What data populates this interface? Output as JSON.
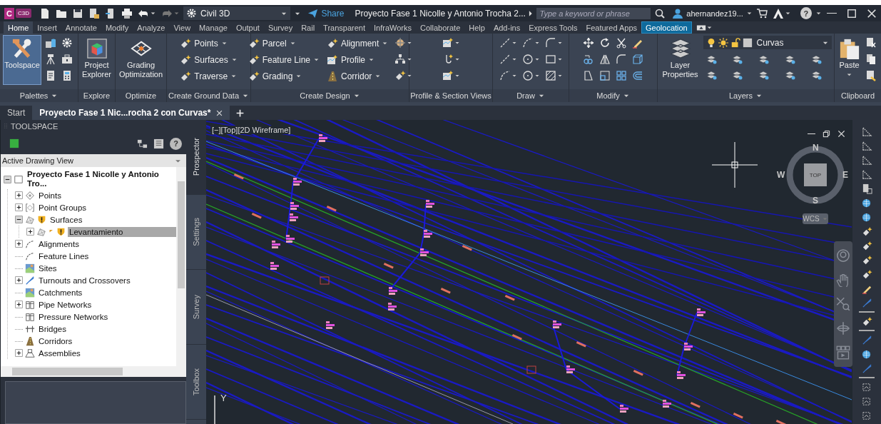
{
  "title_bar": {
    "app_letter": "C",
    "app_badge": "C3D",
    "workspace": "Civil 3D",
    "share": "Share",
    "document_title": "Proyecto Fase 1 Nicolle y Antonio Trocha 2...",
    "search": {
      "placeholder": "Type a keyword or phrase"
    },
    "user": "ahernandez19...",
    "help": "?"
  },
  "ribbon_tabs": [
    {
      "label": "Home",
      "selected": true,
      "highlighted": false
    },
    {
      "label": "Insert",
      "selected": false,
      "highlighted": false
    },
    {
      "label": "Annotate",
      "selected": false,
      "highlighted": false
    },
    {
      "label": "Modify",
      "selected": false,
      "highlighted": false
    },
    {
      "label": "Analyze",
      "selected": false,
      "highlighted": false
    },
    {
      "label": "View",
      "selected": false,
      "highlighted": false
    },
    {
      "label": "Manage",
      "selected": false,
      "highlighted": false
    },
    {
      "label": "Output",
      "selected": false,
      "highlighted": false
    },
    {
      "label": "Survey",
      "selected": false,
      "highlighted": false
    },
    {
      "label": "Rail",
      "selected": false,
      "highlighted": false
    },
    {
      "label": "Transparent",
      "selected": false,
      "highlighted": false
    },
    {
      "label": "InfraWorks",
      "selected": false,
      "highlighted": false
    },
    {
      "label": "Collaborate",
      "selected": false,
      "highlighted": false
    },
    {
      "label": "Help",
      "selected": false,
      "highlighted": false
    },
    {
      "label": "Add-ins",
      "selected": false,
      "highlighted": false
    },
    {
      "label": "Express Tools",
      "selected": false,
      "highlighted": false
    },
    {
      "label": "Featured Apps",
      "selected": false,
      "highlighted": false
    },
    {
      "label": "Geolocation",
      "selected": false,
      "highlighted": true
    }
  ],
  "ribbon_panels": [
    {
      "label": "Palettes",
      "menu": true,
      "buttons": [
        {
          "kind": "large",
          "label": "Toolspace",
          "menu": false,
          "active": true
        }
      ]
    },
    {
      "label": "Explore",
      "menu": false,
      "buttons": [
        {
          "kind": "large",
          "label": "Project Explorer",
          "menu": false,
          "active": false
        }
      ]
    },
    {
      "label": "Optimize",
      "menu": false,
      "buttons": [
        {
          "kind": "large",
          "label": "Grading Optimization",
          "menu": false,
          "active": false
        }
      ]
    },
    {
      "label": "Create Ground Data",
      "menu": true,
      "buttons": [
        {
          "kind": "small",
          "label": "Points",
          "menu": true,
          "active": false
        },
        {
          "kind": "small",
          "label": "Surfaces",
          "menu": true,
          "active": false
        },
        {
          "kind": "small",
          "label": "Traverse",
          "menu": true,
          "active": false
        }
      ]
    },
    {
      "label": "Create Design",
      "menu": true,
      "buttons": [
        {
          "kind": "small",
          "label": "Parcel",
          "menu": true,
          "active": false
        },
        {
          "kind": "small",
          "label": "Feature Line",
          "menu": true,
          "active": false
        },
        {
          "kind": "small",
          "label": "Grading",
          "menu": true,
          "active": false
        },
        {
          "kind": "small",
          "label": "Alignment",
          "menu": true,
          "active": false
        },
        {
          "kind": "small",
          "label": "Profile",
          "menu": true,
          "active": false
        },
        {
          "kind": "small",
          "label": "Corridor",
          "menu": true,
          "active": false
        }
      ]
    },
    {
      "label": "Profile & Section Views",
      "menu": false
    },
    {
      "label": "Draw",
      "menu": true
    },
    {
      "label": "Modify",
      "menu": true
    },
    {
      "label": "Layers",
      "menu": true,
      "buttons": [
        {
          "kind": "large",
          "label": "Layer Properties",
          "menu": false,
          "active": false
        },
        {
          "kind": "layer",
          "label": "Curvas",
          "menu": true,
          "active": false
        }
      ]
    },
    {
      "label": "Clipboard",
      "menu": false,
      "buttons": [
        {
          "kind": "large",
          "label": "Paste",
          "menu": true,
          "active": false
        }
      ]
    }
  ],
  "document_tabs": [
    {
      "label": "Start",
      "selected": false,
      "closable": false
    },
    {
      "label": "Proyecto Fase 1 Nic...rocha 2 con Curvas*",
      "selected": true,
      "closable": true
    }
  ],
  "toolspace": {
    "title": "TOOLSPACE",
    "help": "?",
    "view": "Active Drawing View",
    "tree": {
      "label": "Proyecto Fase 1 Nicolle y Antonio Tro...",
      "expandable": true,
      "expanded": true,
      "warning": false,
      "selected": false,
      "children": [
        {
          "label": "Points",
          "expandable": true,
          "expanded": false,
          "warning": false,
          "selected": false
        },
        {
          "label": "Point Groups",
          "expandable": true,
          "expanded": false,
          "warning": false,
          "selected": false
        },
        {
          "label": "Surfaces",
          "expandable": true,
          "expanded": true,
          "warning": true,
          "selected": false,
          "children": [
            {
              "label": "Levantamiento",
              "expandable": true,
              "expanded": false,
              "warning": true,
              "selected": true
            }
          ]
        },
        {
          "label": "Alignments",
          "expandable": true,
          "expanded": false,
          "warning": false,
          "selected": false
        },
        {
          "label": "Feature Lines",
          "expandable": false,
          "warning": false,
          "selected": false
        },
        {
          "label": "Sites",
          "expandable": false,
          "warning": false,
          "selected": false
        },
        {
          "label": "Turnouts and Crossovers",
          "expandable": true,
          "expanded": false,
          "warning": false,
          "selected": false
        },
        {
          "label": "Catchments",
          "expandable": false,
          "warning": false,
          "selected": false
        },
        {
          "label": "Pipe Networks",
          "expandable": true,
          "expanded": false,
          "warning": false,
          "selected": false
        },
        {
          "label": "Pressure Networks",
          "expandable": false,
          "warning": false,
          "selected": false
        },
        {
          "label": "Bridges",
          "expandable": false,
          "warning": false,
          "selected": false
        },
        {
          "label": "Corridors",
          "expandable": false,
          "warning": false,
          "selected": false
        },
        {
          "label": "Assemblies",
          "expandable": true,
          "expanded": false,
          "warning": false,
          "selected": false
        }
      ]
    },
    "side_tabs": [
      {
        "label": "Prospector",
        "selected": true
      },
      {
        "label": "Settings",
        "selected": false
      },
      {
        "label": "Survey",
        "selected": false
      },
      {
        "label": "Toolbox",
        "selected": false
      }
    ]
  },
  "viewport": {
    "label": "[−][Top][2D Wireframe]",
    "compass": {
      "north": "N",
      "west": "W",
      "east": "E",
      "south": "S",
      "face": "TOP"
    },
    "ucs_menu": "WCS",
    "axis_label": "Y"
  }
}
